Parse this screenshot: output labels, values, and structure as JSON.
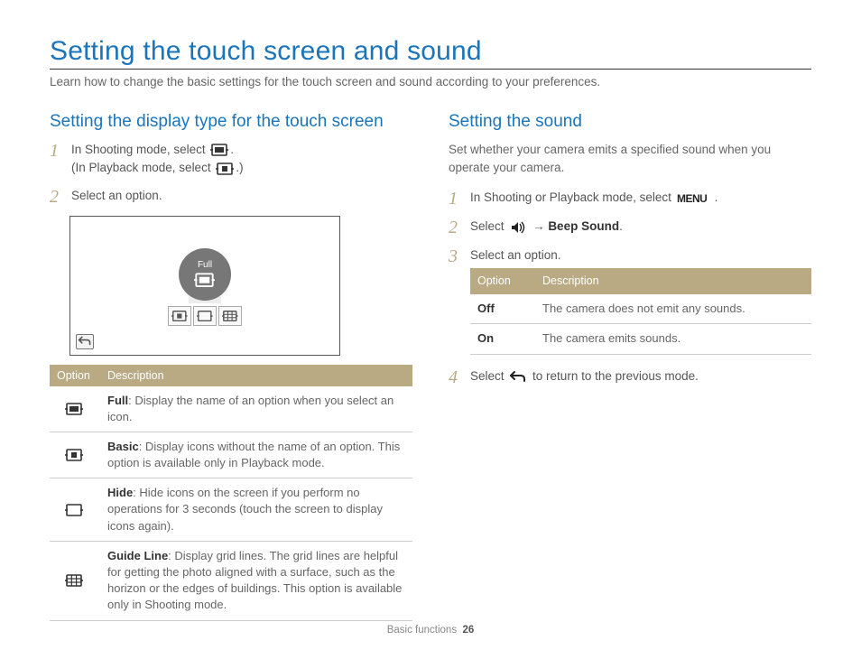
{
  "page_title": "Setting the touch screen and sound",
  "intro": "Learn how to change the basic settings for the touch screen and sound according to your preferences.",
  "left": {
    "heading": "Setting the display type for the touch screen",
    "step1_line1_a": "In Shooting mode, select ",
    "step1_line1_b": ".",
    "step1_line2_a": "(In Playback mode, select ",
    "step1_line2_b": ".)",
    "step2": "Select an option.",
    "illust_label": "Full",
    "table": {
      "head_option": "Option",
      "head_desc": "Description",
      "rows": [
        {
          "lead": "Full",
          "desc": ": Display the name of an option when you select an icon."
        },
        {
          "lead": "Basic",
          "desc": ": Display icons without the name of an option. This option is available only in Playback mode."
        },
        {
          "lead": "Hide",
          "desc": ": Hide icons on the screen if you perform no operations for 3 seconds (touch the screen to display icons again)."
        },
        {
          "lead": "Guide Line",
          "desc": ": Display grid lines. The grid lines are helpful for getting the photo aligned with a surface, such as the horizon or the edges of buildings. This option is available only in Shooting mode."
        }
      ]
    }
  },
  "right": {
    "heading": "Setting the sound",
    "subintro": "Set whether your camera emits a specified sound when you operate your camera.",
    "step1_a": "In Shooting or Playback mode, select ",
    "step1_b": ".",
    "step2_a": "Select ",
    "step2_arrow": " → ",
    "step2_bold": "Beep Sound",
    "step2_b": ".",
    "step3": "Select an option.",
    "table": {
      "head_option": "Option",
      "head_desc": "Description",
      "rows": [
        {
          "opt": "Off",
          "desc": "The camera does not emit any sounds."
        },
        {
          "opt": "On",
          "desc": "The camera emits sounds."
        }
      ]
    },
    "step4_a": "Select ",
    "step4_b": " to return to the previous mode."
  },
  "footer_section": "Basic functions",
  "footer_page": "26"
}
